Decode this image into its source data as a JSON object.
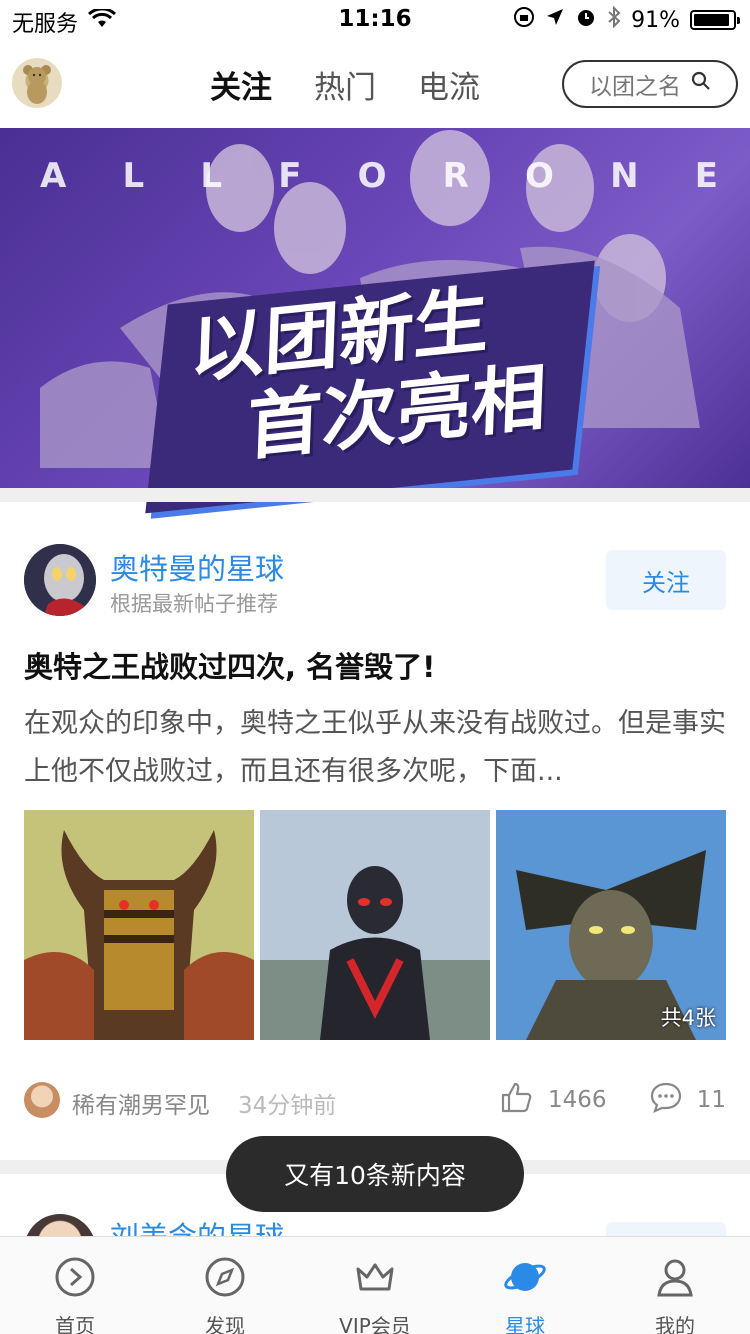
{
  "status_bar": {
    "carrier": "无服务",
    "time": "11:16",
    "battery_text": "91%",
    "battery_level": 0.91
  },
  "header": {
    "tabs": [
      {
        "label": "关注",
        "active": true
      },
      {
        "label": "热门",
        "active": false
      },
      {
        "label": "电流",
        "active": false
      }
    ],
    "search_placeholder": "以团之名",
    "icons": {
      "avatar": "teddy-bear-avatar",
      "search": "search-icon"
    }
  },
  "banner": {
    "top_letters": [
      "A",
      "L",
      "L",
      "F",
      "O",
      "R",
      "O",
      "N",
      "E"
    ],
    "title_line1": "以团新生",
    "title_line2": "首次亮相"
  },
  "post": {
    "user_name": "奥特曼的星球",
    "user_sub": "根据最新帖子推荐",
    "follow_label": "关注",
    "title": "奥特之王战败过四次, 名誉毁了!",
    "body": "在观众的印象中，奥特之王似乎从来没有战败过。但是事实上他不仅战败过，而且还有很多次呢，下面...",
    "image_count": "共4张",
    "author": "稀有潮男罕见",
    "time": "34分钟前",
    "likes": "1466",
    "comments": "11"
  },
  "next_post": {
    "user_name": "刘美含的星球"
  },
  "toast": "又有10条新内容",
  "bottom_nav": [
    {
      "label": "首页",
      "icon": "play-circle-icon",
      "active": false
    },
    {
      "label": "发现",
      "icon": "compass-icon",
      "active": false
    },
    {
      "label": "VIP会员",
      "icon": "crown-icon",
      "active": false
    },
    {
      "label": "星球",
      "icon": "planet-icon",
      "active": true
    },
    {
      "label": "我的",
      "icon": "profile-icon",
      "active": false
    }
  ],
  "colors": {
    "accent": "#2a8ae6",
    "banner_purple": "#5a3aa6",
    "toast_bg": "#2b2b2b"
  }
}
